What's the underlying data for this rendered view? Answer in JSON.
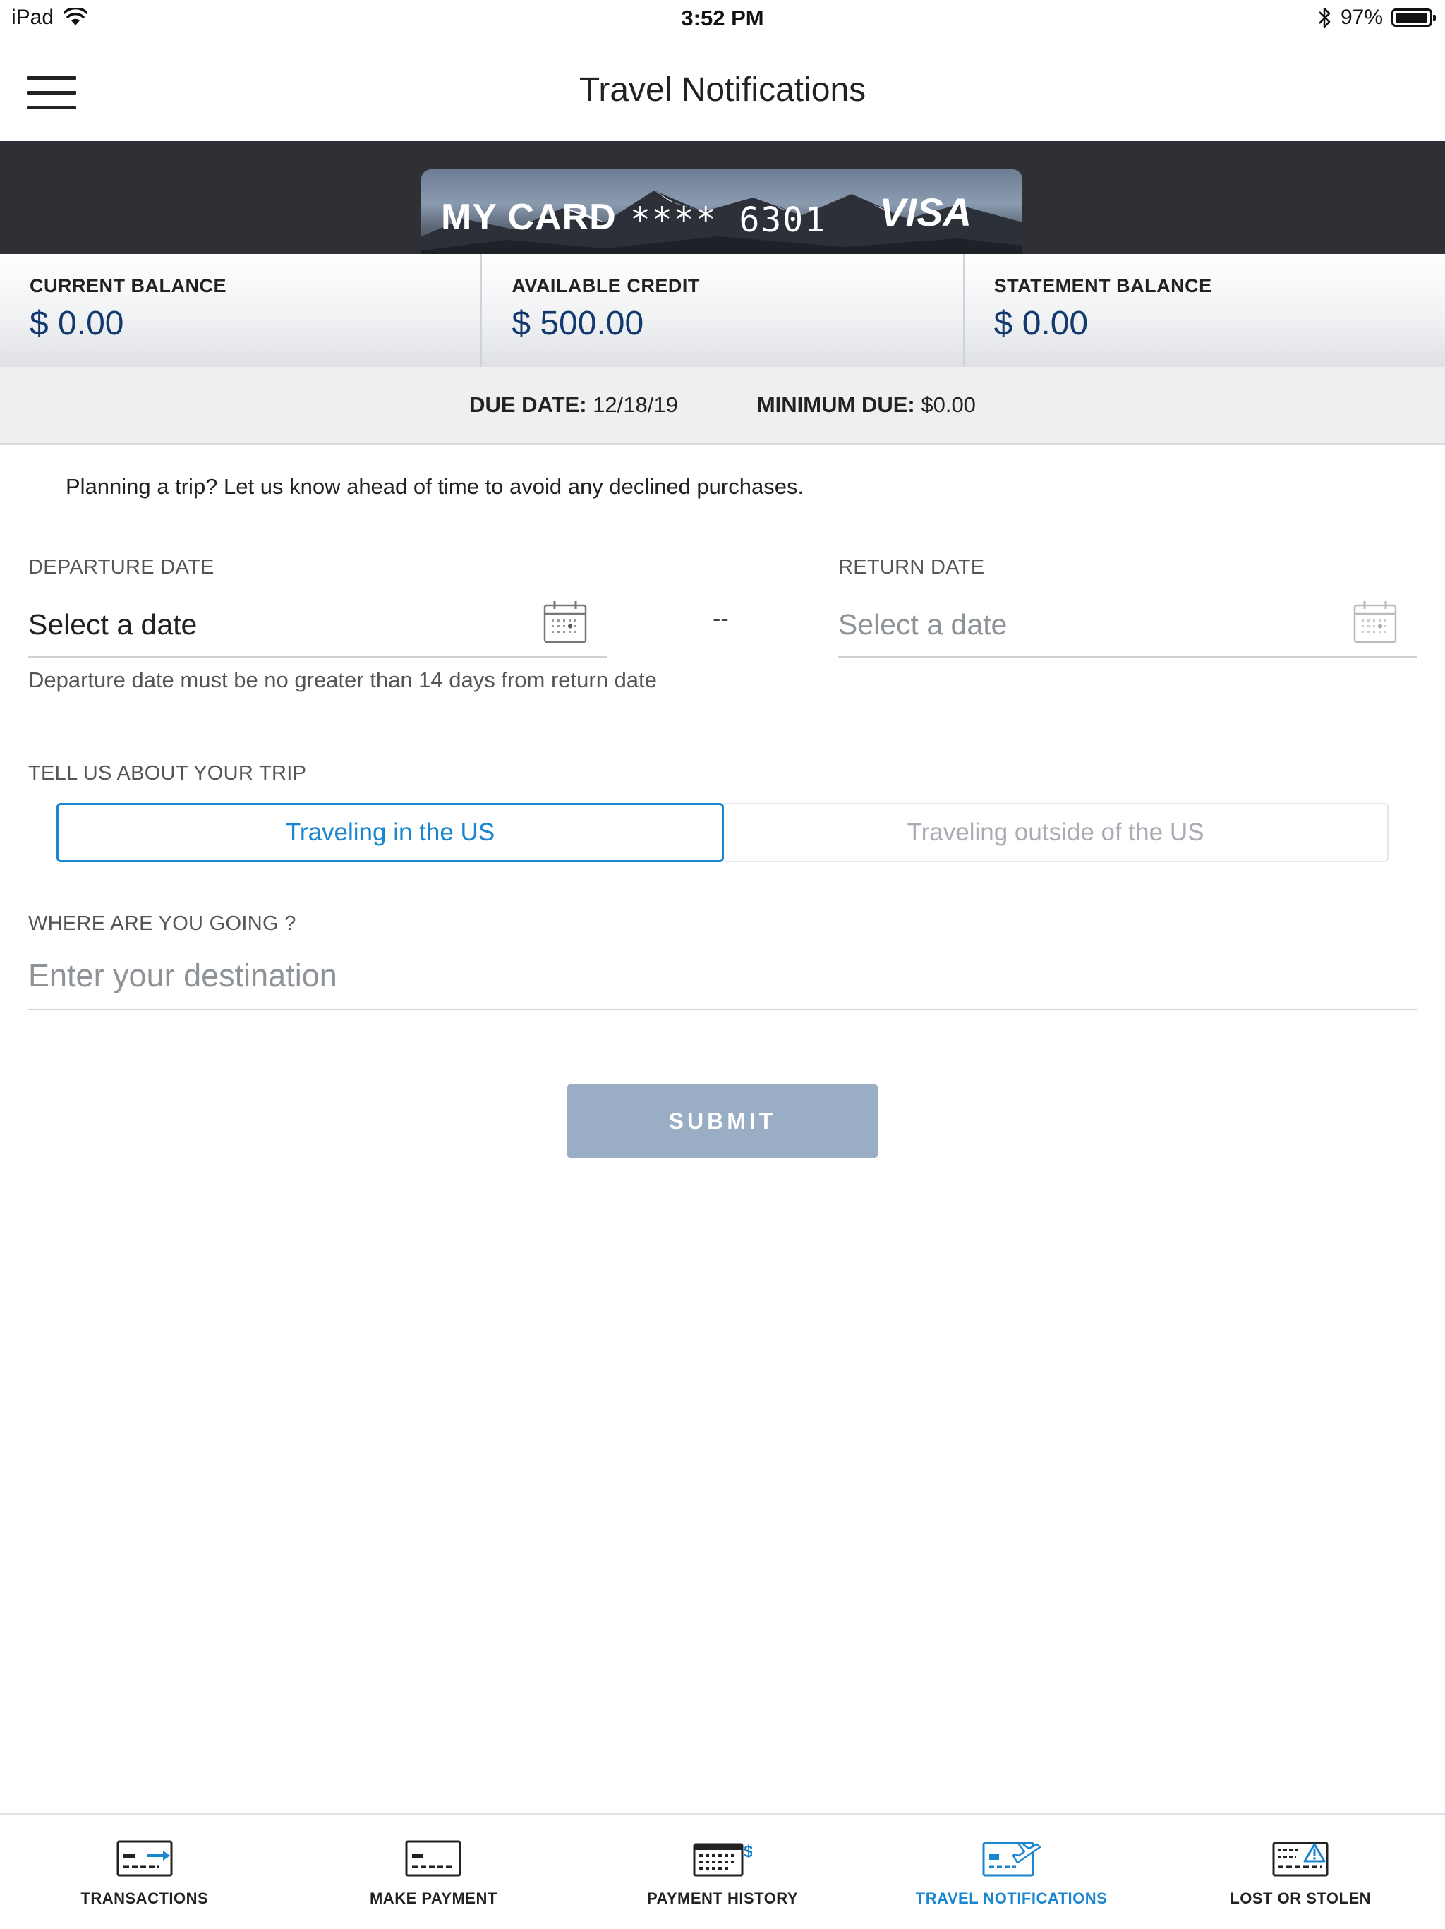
{
  "status_bar": {
    "device": "iPad",
    "time": "3:52 PM",
    "battery_text": "97%",
    "battery_level": 0.97
  },
  "header": {
    "title": "Travel Notifications"
  },
  "card": {
    "name": "MY CARD",
    "masked_number": "**** 6301",
    "brand": "VISA"
  },
  "balances": [
    {
      "label": "CURRENT BALANCE",
      "value": "$ 0.00"
    },
    {
      "label": "AVAILABLE CREDIT",
      "value": "$ 500.00"
    },
    {
      "label": "STATEMENT BALANCE",
      "value": "$ 0.00"
    }
  ],
  "due": {
    "due_date_label": "DUE DATE:",
    "due_date_value": "12/18/19",
    "minimum_due_label": "MINIMUM DUE:",
    "minimum_due_value": "$0.00"
  },
  "form": {
    "intro": "Planning a trip? Let us know ahead of time to avoid any declined purchases.",
    "departure_label": "DEPARTURE DATE",
    "departure_value": "Select a date",
    "separator": "--",
    "return_label": "RETURN DATE",
    "return_value": "Select a date",
    "hint": "Departure date must be no greater than 14 days from return date",
    "trip_label": "TELL US ABOUT YOUR TRIP",
    "trip_options": [
      "Traveling in the US",
      "Traveling outside of the US"
    ],
    "trip_selected": "Traveling in the US",
    "destination_label": "WHERE ARE YOU GOING ?",
    "destination_placeholder": "Enter your destination",
    "destination_value": "",
    "submit_label": "SUBMIT"
  },
  "tabs": [
    {
      "label": "TRANSACTIONS",
      "icon": "transactions-icon"
    },
    {
      "label": "MAKE PAYMENT",
      "icon": "make-payment-icon"
    },
    {
      "label": "PAYMENT HISTORY",
      "icon": "payment-history-icon"
    },
    {
      "label": "TRAVEL NOTIFICATIONS",
      "icon": "travel-notifications-icon"
    },
    {
      "label": "LOST OR STOLEN",
      "icon": "lost-or-stolen-icon"
    }
  ],
  "active_tab": "TRAVEL NOTIFICATIONS",
  "colors": {
    "accent": "#1a86d0",
    "balance_value": "#123a6e",
    "card_band": "#2e3036",
    "submit_disabled": "#99adc4"
  }
}
